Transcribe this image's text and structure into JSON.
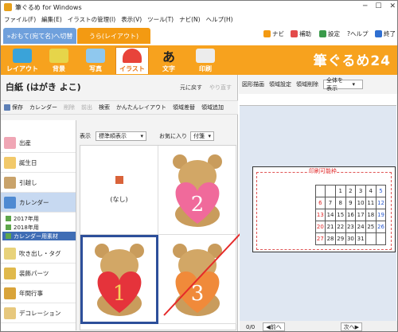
{
  "window": {
    "title": "筆ぐるめ for Windows"
  },
  "menu": [
    "ファイル(F)",
    "編集(E)",
    "イラストの管理(I)",
    "表示(V)",
    "ツール(T)",
    "ナビ(N)",
    "ヘルプ(H)"
  ],
  "modes": {
    "omote": "»おもて(宛て名)へ切替",
    "ura": "うら(レイアウト)"
  },
  "top_actions": {
    "navi": "ナビ",
    "hojo": "補助",
    "settei": "設定",
    "help": "?ヘルプ",
    "end": "終了"
  },
  "ribbon": {
    "items": [
      "レイアウト",
      "背景",
      "写真",
      "イラスト",
      "文字",
      "印刷"
    ],
    "brand": "筆ぐるめ24"
  },
  "card": {
    "title": "白紙 (はがき よこ)",
    "undo": "元に戻す",
    "redo": "やり直す"
  },
  "toolbar": {
    "save": "保存",
    "calendar": "カレンダー",
    "delete": "削除",
    "prev": "前出",
    "search": "検索",
    "layout": "かんたんレイアウト",
    "area_replace": "領域差替",
    "area_add": "領域追加"
  },
  "categories": {
    "items": [
      "出産",
      "誕生日",
      "引越し",
      "カレンダー",
      "吹き出し・タグ",
      "装飾パーツ",
      "年間行事",
      "デコレーション"
    ],
    "subs": [
      "2017年用",
      "2018年用",
      "カレンダー用素材"
    ]
  },
  "gallery": {
    "view_label": "表示",
    "sort_value": "標準順表示",
    "favorites_label": "お気に入り",
    "tag_label": "付箋",
    "none_label": "(なし)"
  },
  "right": {
    "draw": "図形描画",
    "area_set": "領域設定",
    "area_del": "領域削除",
    "view_all": "全体を表示",
    "print_area": "印刷可能枠"
  },
  "calendar": {
    "rows": [
      [
        "",
        "",
        "1",
        "2",
        "3",
        "4",
        "5"
      ],
      [
        "6",
        "7",
        "8",
        "9",
        "10",
        "11",
        "12"
      ],
      [
        "13",
        "14",
        "15",
        "16",
        "17",
        "18",
        "19"
      ],
      [
        "20",
        "21",
        "22",
        "23",
        "24",
        "25",
        "26"
      ],
      [
        "27",
        "28",
        "29",
        "30",
        "31",
        "",
        ""
      ]
    ]
  },
  "status": {
    "page": "0/0",
    "prev": "前へ",
    "next": "次へ"
  },
  "colors": {
    "accent": "#f7a21e",
    "blue_mode": "#6fa0dc",
    "selection": "#3f6db5"
  }
}
